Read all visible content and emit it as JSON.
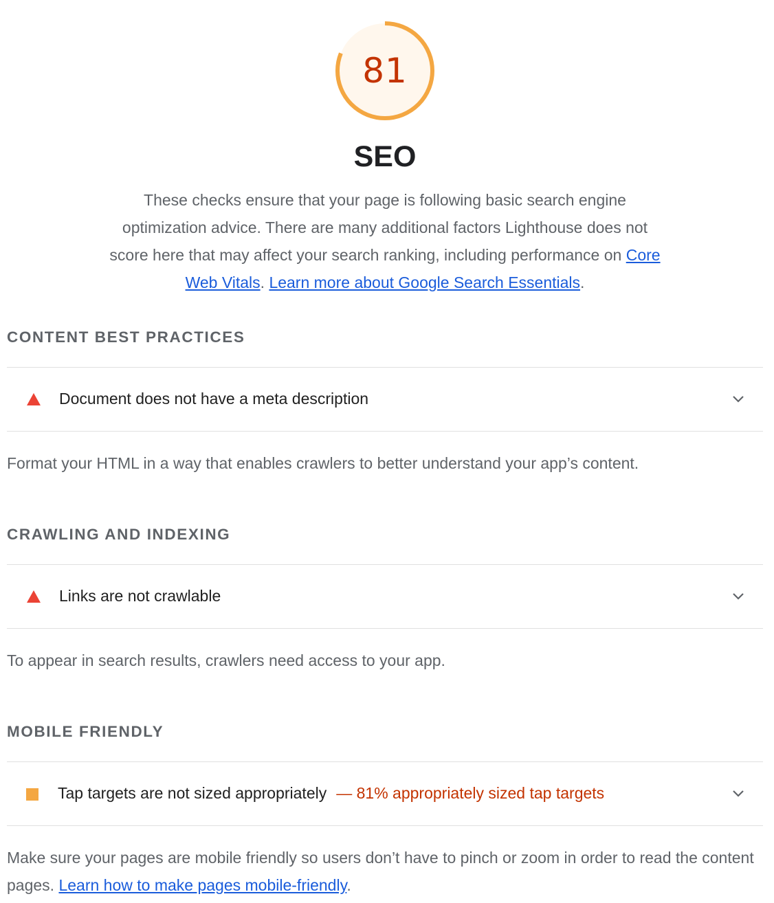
{
  "score": {
    "value": "81",
    "fraction": 0.81,
    "color": "#f4a742",
    "fill_color": "#fff7ed",
    "text_color": "#c33300"
  },
  "category": {
    "title": "SEO",
    "description_pre": "These checks ensure that your page is following basic search engine optimization advice. There are many additional factors Lighthouse does not score here that may affect your search ranking, including performance on ",
    "link_core_web_vitals": "Core Web Vitals",
    "separator": ". ",
    "link_learn_more": "Learn more about Google Search Essentials",
    "description_post": "."
  },
  "groups": [
    {
      "heading": "CONTENT BEST PRACTICES",
      "audit": {
        "status_icon": "fail-triangle-icon",
        "title": "Document does not have a meta description",
        "display_value": ""
      },
      "description": "Format your HTML in a way that enables crawlers to better understand your app’s content."
    },
    {
      "heading": "CRAWLING AND INDEXING",
      "audit": {
        "status_icon": "fail-triangle-icon",
        "title": "Links are not crawlable",
        "display_value": ""
      },
      "description": "To appear in search results, crawlers need access to your app."
    },
    {
      "heading": "MOBILE FRIENDLY",
      "audit": {
        "status_icon": "average-square-icon",
        "title": "Tap targets are not sized appropriately",
        "display_value": "— 81% appropriately sized tap targets"
      },
      "description_pre": "Make sure your pages are mobile friendly so users don’t have to pinch or zoom in order to read the content pages. ",
      "link": "Learn how to make pages mobile-friendly",
      "description_post": "."
    }
  ],
  "colors": {
    "fail": "#eb4335",
    "average": "#f4a742",
    "link": "#1a5cdb",
    "display_value": "#c33300"
  }
}
